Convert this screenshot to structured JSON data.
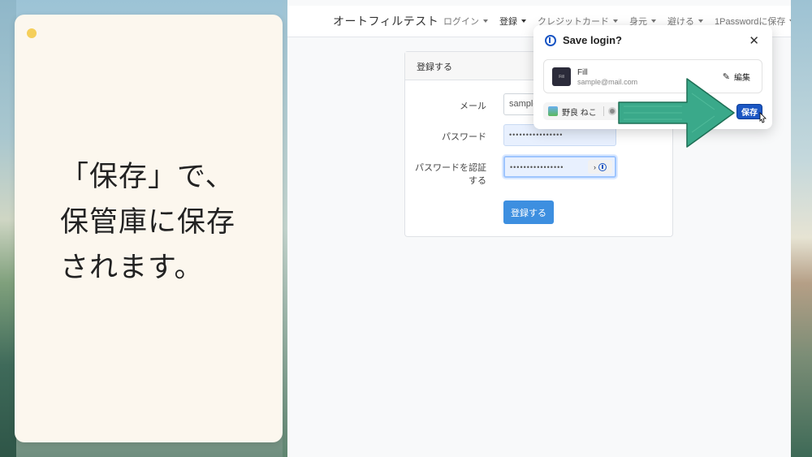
{
  "note": {
    "lines": [
      "「保存」で、",
      "保管庫に保存",
      "されます。"
    ]
  },
  "navbar": {
    "brand": "オートフィルテスト",
    "items": [
      {
        "label": "ログイン"
      },
      {
        "label": "登録"
      },
      {
        "label": "クレジットカード"
      },
      {
        "label": "身元"
      },
      {
        "label": "避ける"
      },
      {
        "label": "1Passwordに保存"
      }
    ]
  },
  "form": {
    "header": "登録する",
    "email_label": "メール",
    "email_value": "sample@mail.com",
    "password_label": "パスワード",
    "password_value": "••••••••••••••••",
    "confirm_label_line1": "パスワードを認証",
    "confirm_label_line2": "する",
    "confirm_value": "••••••••••••••••",
    "submit_label": "登録する"
  },
  "popup": {
    "title": "Save login?",
    "close_glyph": "✕",
    "item_title": "Fill",
    "item_subtitle": "sample@mail.com",
    "item_thumb_text": "Fill",
    "edit_label": "編集",
    "vault_name": "野良 ねこ",
    "save_label": "保存"
  },
  "colors": {
    "accent_button": "#3d8fe0",
    "save_button": "#1b56c3",
    "arrow_fill": "#3aa98a",
    "note_bg": "#fcf7ee"
  }
}
